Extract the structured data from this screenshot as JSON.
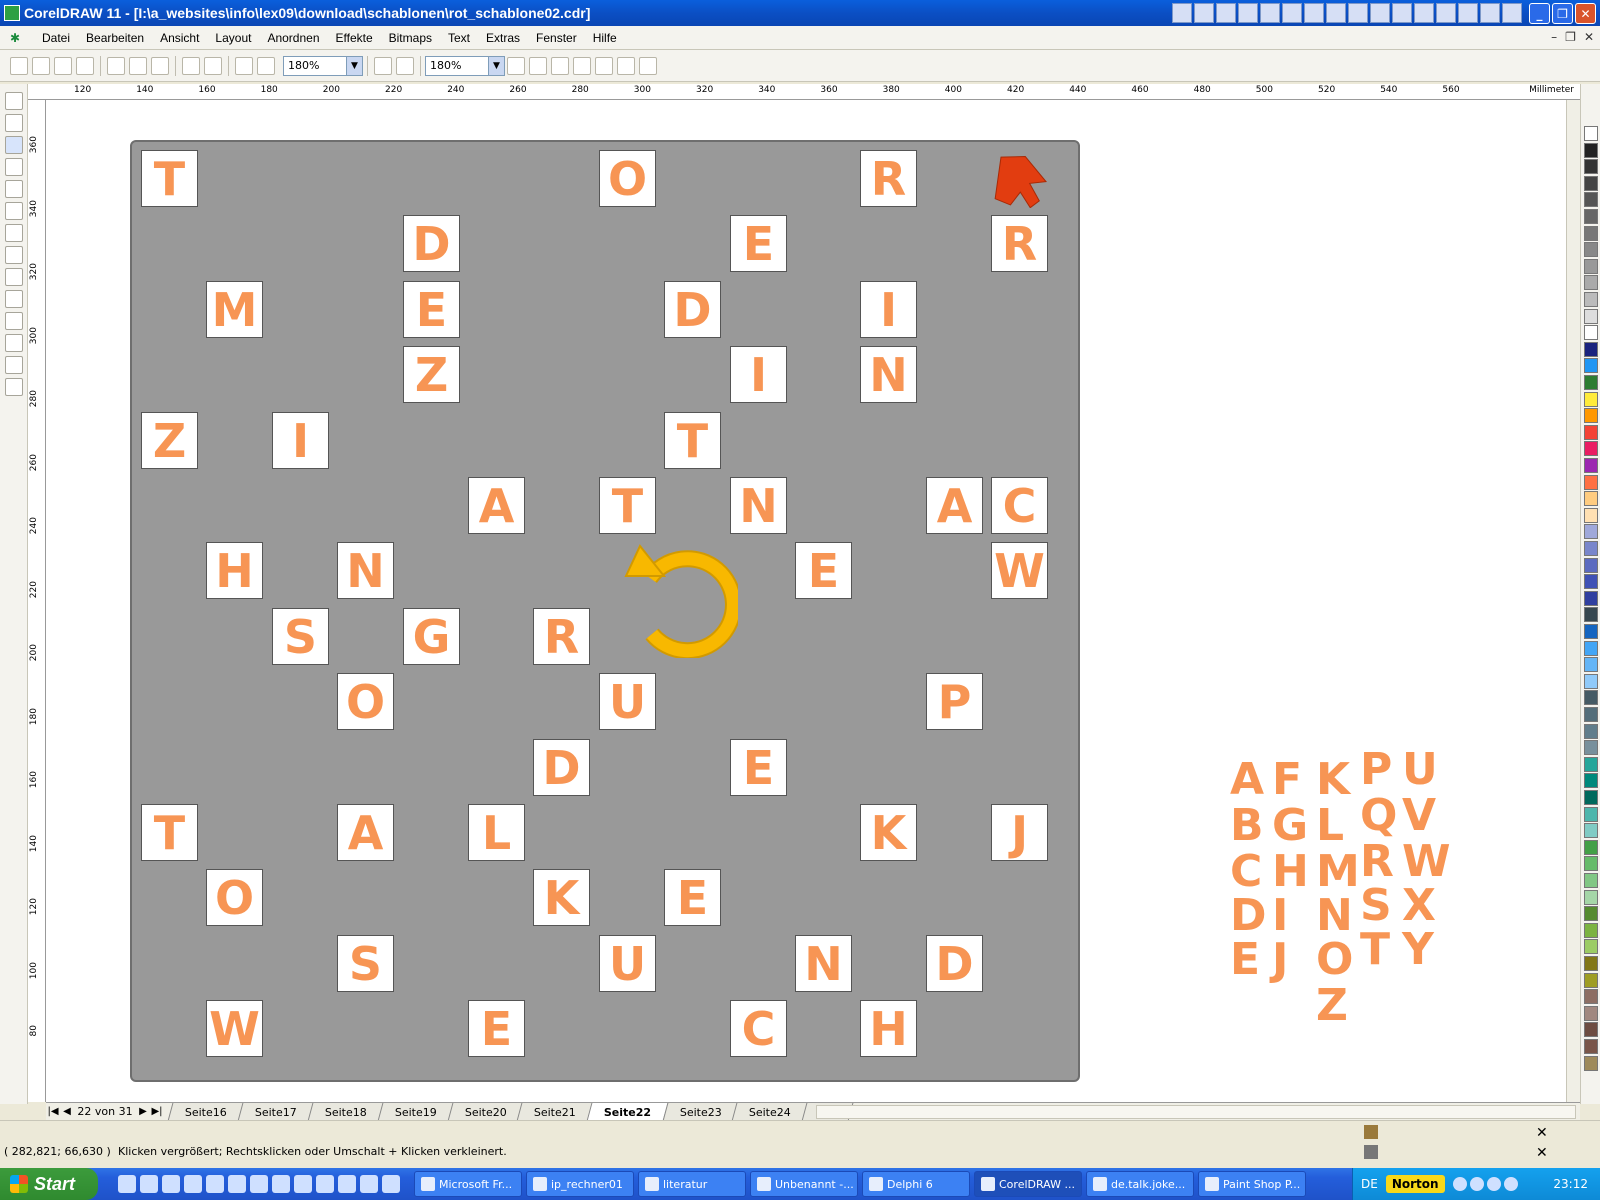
{
  "window": {
    "title": "CorelDRAW 11 - [I:\\a_websites\\info\\lex09\\download\\schablonen\\rot_schablone02.cdr]"
  },
  "menu": [
    "Datei",
    "Bearbeiten",
    "Ansicht",
    "Layout",
    "Anordnen",
    "Effekte",
    "Bitmaps",
    "Text",
    "Extras",
    "Fenster",
    "Hilfe"
  ],
  "toolbar": {
    "zoom1": "180%",
    "zoom2": "180%"
  },
  "ruler": {
    "h_ticks": [
      "120",
      "140",
      "160",
      "180",
      "200",
      "220",
      "240",
      "260",
      "280",
      "300",
      "320",
      "340",
      "360",
      "380",
      "400",
      "420",
      "440",
      "460",
      "480",
      "500",
      "520",
      "540",
      "560"
    ],
    "v_ticks": [
      "360",
      "340",
      "320",
      "300",
      "280",
      "260",
      "240",
      "220",
      "200",
      "180",
      "160",
      "140",
      "120",
      "100",
      "80"
    ],
    "unit": "Millimeter"
  },
  "colors": {
    "letter": "#f79554",
    "board": "#999999",
    "arrow_red": "#e23d10",
    "arrow_yellow": "#f8b800"
  },
  "icons": {
    "arrow": "red-arrow-icon",
    "rotate": "rotate-ccw-icon"
  },
  "board": {
    "tiles": [
      {
        "letter": "T",
        "col": 0,
        "row": 0
      },
      {
        "letter": "O",
        "col": 7,
        "row": 0
      },
      {
        "letter": "R",
        "col": 11,
        "row": 0
      },
      {
        "letter": "D",
        "col": 4,
        "row": 1
      },
      {
        "letter": "E",
        "col": 9,
        "row": 1
      },
      {
        "letter": "R",
        "col": 13,
        "row": 1
      },
      {
        "letter": "M",
        "col": 1,
        "row": 2
      },
      {
        "letter": "E",
        "col": 4,
        "row": 2
      },
      {
        "letter": "D",
        "col": 8,
        "row": 2
      },
      {
        "letter": "I",
        "col": 11,
        "row": 2
      },
      {
        "letter": "Z",
        "col": 4,
        "row": 3
      },
      {
        "letter": "I",
        "col": 9,
        "row": 3
      },
      {
        "letter": "N",
        "col": 11,
        "row": 3
      },
      {
        "letter": "Z",
        "col": 0,
        "row": 4
      },
      {
        "letter": "I",
        "col": 2,
        "row": 4
      },
      {
        "letter": "T",
        "col": 8,
        "row": 4
      },
      {
        "letter": "A",
        "col": 5,
        "row": 5
      },
      {
        "letter": "T",
        "col": 7,
        "row": 5
      },
      {
        "letter": "N",
        "col": 9,
        "row": 5
      },
      {
        "letter": "A",
        "col": 12,
        "row": 5
      },
      {
        "letter": "C",
        "col": 13,
        "row": 5
      },
      {
        "letter": "H",
        "col": 1,
        "row": 6
      },
      {
        "letter": "N",
        "col": 3,
        "row": 6
      },
      {
        "letter": "E",
        "col": 10,
        "row": 6
      },
      {
        "letter": "W",
        "col": 13,
        "row": 6
      },
      {
        "letter": "S",
        "col": 2,
        "row": 7
      },
      {
        "letter": "G",
        "col": 4,
        "row": 7
      },
      {
        "letter": "R",
        "col": 6,
        "row": 7
      },
      {
        "letter": "O",
        "col": 3,
        "row": 8
      },
      {
        "letter": "U",
        "col": 7,
        "row": 8
      },
      {
        "letter": "P",
        "col": 12,
        "row": 8
      },
      {
        "letter": "D",
        "col": 6,
        "row": 9
      },
      {
        "letter": "E",
        "col": 9,
        "row": 9
      },
      {
        "letter": "T",
        "col": 0,
        "row": 10
      },
      {
        "letter": "A",
        "col": 3,
        "row": 10
      },
      {
        "letter": "L",
        "col": 5,
        "row": 10
      },
      {
        "letter": "K",
        "col": 11,
        "row": 10
      },
      {
        "letter": "J",
        "col": 13,
        "row": 10
      },
      {
        "letter": "O",
        "col": 1,
        "row": 11
      },
      {
        "letter": "K",
        "col": 6,
        "row": 11
      },
      {
        "letter": "E",
        "col": 8,
        "row": 11
      },
      {
        "letter": "S",
        "col": 3,
        "row": 12
      },
      {
        "letter": "U",
        "col": 7,
        "row": 12
      },
      {
        "letter": "N",
        "col": 10,
        "row": 12
      },
      {
        "letter": "D",
        "col": 12,
        "row": 12
      },
      {
        "letter": "W",
        "col": 1,
        "row": 13
      },
      {
        "letter": "E",
        "col": 5,
        "row": 13
      },
      {
        "letter": "C",
        "col": 9,
        "row": 13
      },
      {
        "letter": "H",
        "col": 11,
        "row": 13
      }
    ]
  },
  "legend": {
    "columns": [
      [
        "A",
        "B",
        "C",
        "D",
        "E"
      ],
      [
        "F",
        "G",
        "H",
        "I",
        "J"
      ],
      [
        "K",
        "L",
        "M",
        "N",
        "O"
      ],
      [
        "P",
        "Q",
        "R",
        "S",
        "T"
      ],
      [
        "U",
        "V",
        "W",
        "X",
        "Y"
      ]
    ],
    "extra": "Z"
  },
  "pages": {
    "count": "22 von 31",
    "tabs": [
      "Seite16",
      "Seite17",
      "Seite18",
      "Seite19",
      "Seite20",
      "Seite21",
      "Seite22",
      "Seite23",
      "Seite24",
      "Sei"
    ],
    "active": "Seite22"
  },
  "status": {
    "coords": "( 282,821; 66,630 )",
    "hint": "Klicken vergrößert; Rechtsklicken oder Umschalt + Klicken verkleinert."
  },
  "taskbar": {
    "start": "Start",
    "tasks": [
      "Microsoft Fr...",
      "ip_rechner01",
      "literatur",
      "Unbenannt -...",
      "Delphi 6",
      "CorelDRAW ...",
      "de.talk.joke...",
      "Paint Shop P..."
    ],
    "active_task": "CorelDRAW ...",
    "lang": "DE",
    "norton": "Norton",
    "clock": "23:12"
  }
}
